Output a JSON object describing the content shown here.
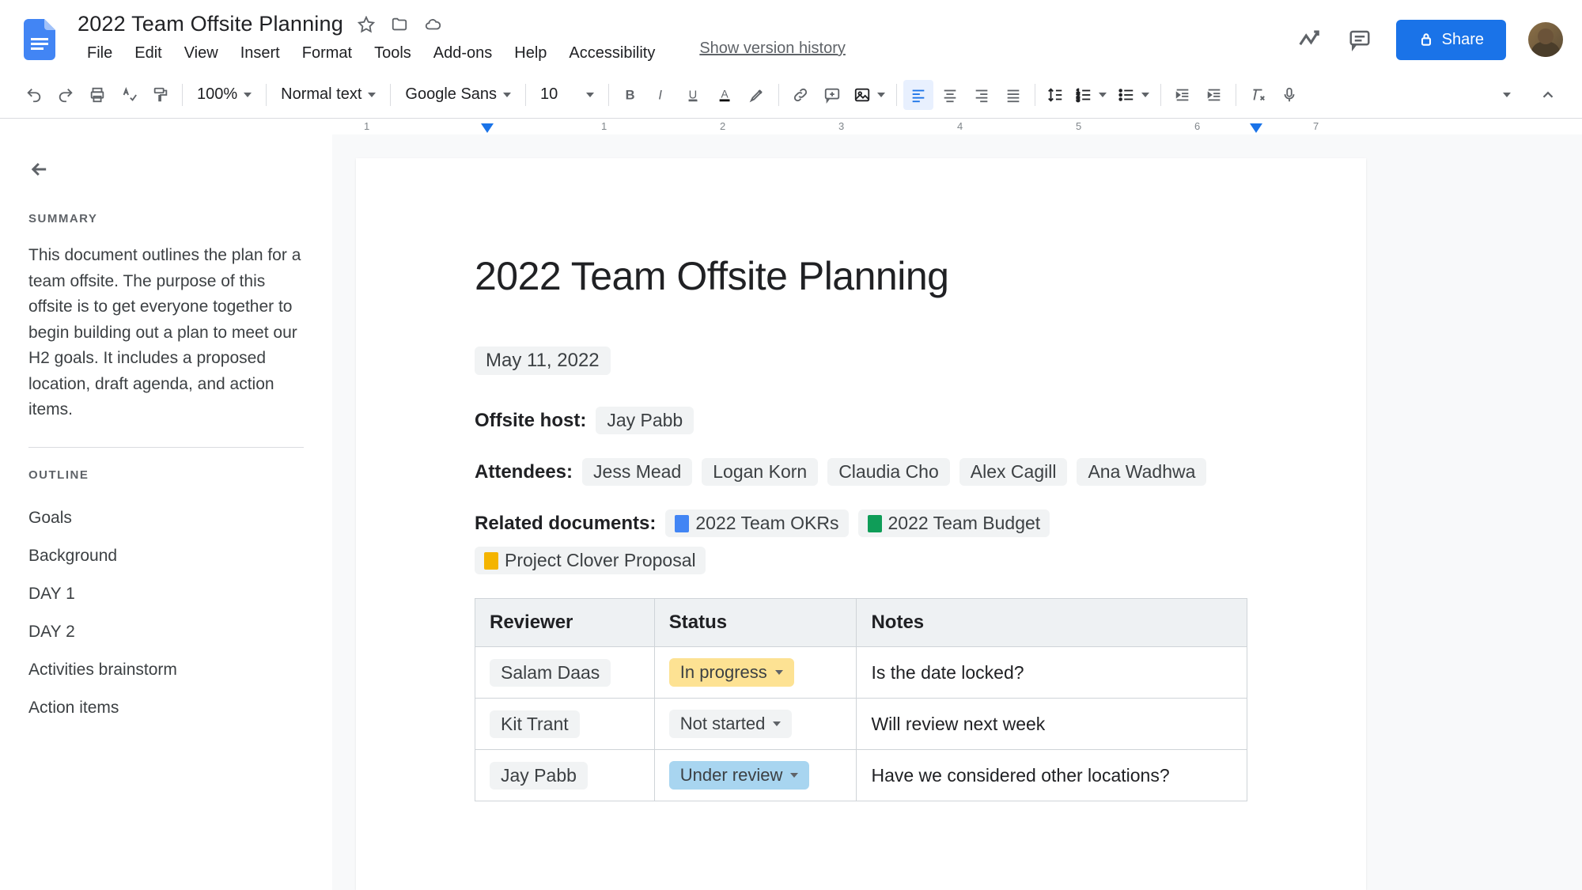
{
  "header": {
    "title": "2022 Team Offsite Planning",
    "menus": [
      "File",
      "Edit",
      "View",
      "Insert",
      "Format",
      "Tools",
      "Add-ons",
      "Help",
      "Accessibility"
    ],
    "version_link": "Show version history",
    "share_label": "Share"
  },
  "toolbar": {
    "zoom": "100%",
    "style": "Normal text",
    "font": "Google Sans",
    "size": "10"
  },
  "ruler": {
    "numbers": [
      "1",
      "1",
      "2",
      "3",
      "4",
      "5",
      "6",
      "7"
    ]
  },
  "sidebar": {
    "summary_label": "SUMMARY",
    "summary_text": "This document outlines the plan for a team offsite. The purpose of this offsite is to get everyone together to begin building out a plan to meet our H2 goals. It includes a proposed location, draft agenda, and action items.",
    "outline_label": "OUTLINE",
    "outline": [
      "Goals",
      "Background",
      "DAY 1",
      "DAY 2",
      "Activities brainstorm",
      "Action items"
    ]
  },
  "document": {
    "heading": "2022 Team Offsite Planning",
    "date": "May 11, 2022",
    "host_label": "Offsite host:",
    "host": "Jay Pabb",
    "attendees_label": "Attendees:",
    "attendees": [
      "Jess Mead",
      "Logan Korn",
      "Claudia Cho",
      "Alex Cagill",
      "Ana Wadhwa"
    ],
    "related_label": "Related documents:",
    "related": [
      {
        "name": "2022 Team OKRs",
        "icon": "blue"
      },
      {
        "name": "2022 Team Budget",
        "icon": "green"
      },
      {
        "name": "Project Clover Proposal",
        "icon": "yellow"
      }
    ],
    "table": {
      "headers": [
        "Reviewer",
        "Status",
        "Notes"
      ],
      "rows": [
        {
          "reviewer": "Salam Daas",
          "status": "In progress",
          "status_class": "status-progress",
          "notes": "Is the date locked?"
        },
        {
          "reviewer": "Kit Trant",
          "status": "Not started",
          "status_class": "status-notstarted",
          "notes": "Will review next week"
        },
        {
          "reviewer": "Jay Pabb",
          "status": "Under review",
          "status_class": "status-review",
          "notes": "Have we considered other locations?"
        }
      ]
    }
  }
}
